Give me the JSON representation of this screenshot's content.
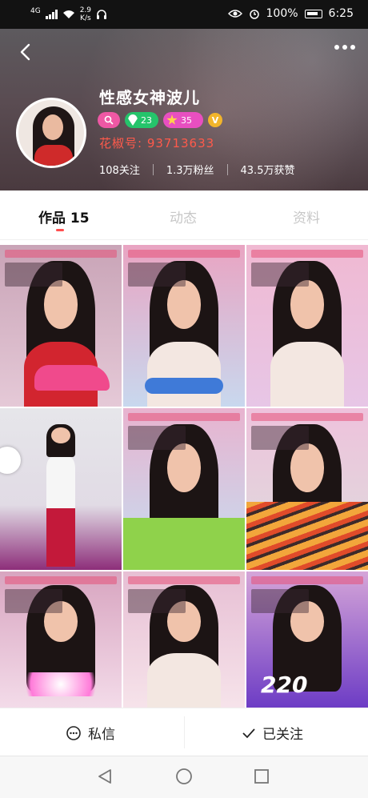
{
  "status_bar": {
    "signal_label": "4G",
    "net_speed": "2.9\nK/s",
    "battery_percent": "100%",
    "time": "6:25"
  },
  "profile": {
    "name": "性感女神波儿",
    "badges": [
      {
        "name": "search-badge",
        "value": ""
      },
      {
        "name": "gem-badge",
        "value": "23"
      },
      {
        "name": "star-badge",
        "value": "35"
      },
      {
        "name": "v-badge",
        "value": "V"
      }
    ],
    "uid": "花椒号: 93713633",
    "stats": [
      {
        "label": "108关注"
      },
      {
        "label": "1.3万粉丝"
      },
      {
        "label": "43.5万获赞"
      }
    ]
  },
  "tabs": [
    {
      "label": "作品 15",
      "active": true
    },
    {
      "label": "动态",
      "active": false
    },
    {
      "label": "资料",
      "active": false
    }
  ],
  "grid": {
    "tiles": [
      {
        "name": "video-tile-1"
      },
      {
        "name": "video-tile-2"
      },
      {
        "name": "video-tile-3"
      },
      {
        "name": "video-tile-4"
      },
      {
        "name": "video-tile-5"
      },
      {
        "name": "video-tile-6"
      },
      {
        "name": "video-tile-7"
      },
      {
        "name": "video-tile-8"
      },
      {
        "name": "video-tile-9"
      }
    ],
    "tile_9_overlay": "220"
  },
  "actions": {
    "message": "私信",
    "followed": "已关注"
  },
  "colors": {
    "accent_red": "#ff4e4e",
    "uid_color": "#ff5a4b"
  }
}
